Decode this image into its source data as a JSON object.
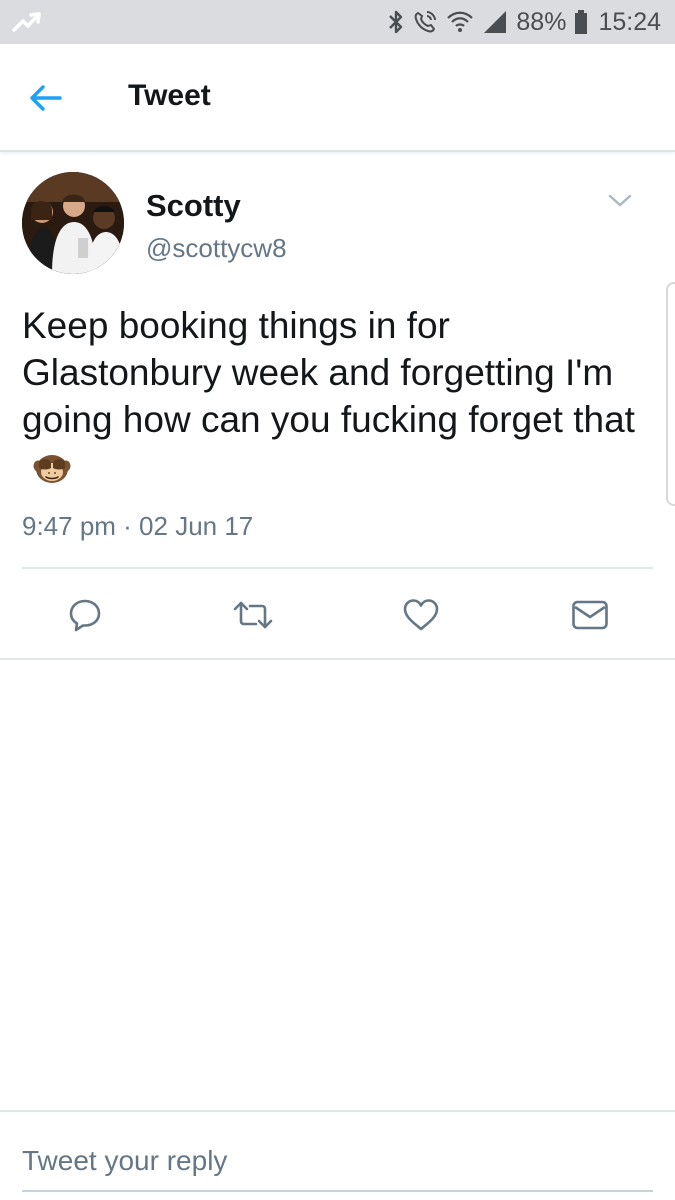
{
  "status_bar": {
    "battery_percent": "88%",
    "time": "15:24"
  },
  "header": {
    "title": "Tweet"
  },
  "tweet": {
    "author_name": "Scotty",
    "author_handle": "@scottycw8",
    "text": "Keep booking things in for Glastonbury week and forgetting I'm going how can you fucking forget that",
    "emoji": "see-no-evil-monkey",
    "timestamp": "9:47 pm · 02 Jun 17"
  },
  "actions": [
    "reply",
    "retweet",
    "like",
    "direct-message"
  ],
  "reply": {
    "placeholder": "Tweet your reply"
  },
  "colors": {
    "accent": "#1da1f2",
    "secondary_text": "#657786",
    "divider": "#e1e8ed",
    "status_bar_bg": "#dadcdf"
  }
}
